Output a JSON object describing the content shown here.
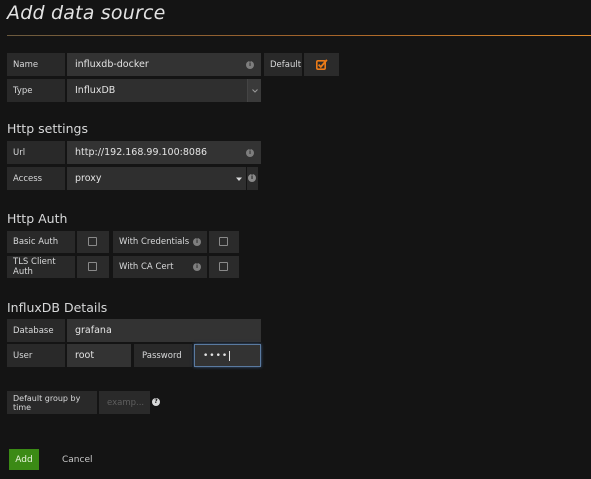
{
  "page": {
    "title": "Add data source"
  },
  "basic": {
    "name_label": "Name",
    "name_value": "influxdb-docker",
    "default_label": "Default",
    "default_checked": true,
    "type_label": "Type",
    "type_value": "InfluxDB"
  },
  "http_settings": {
    "heading": "Http settings",
    "url_label": "Url",
    "url_value": "http://192.168.99.100:8086",
    "access_label": "Access",
    "access_value": "proxy"
  },
  "http_auth": {
    "heading": "Http Auth",
    "basic_auth_label": "Basic Auth",
    "with_credentials_label": "With Credentials",
    "tls_client_auth_label": "TLS Client Auth",
    "with_ca_cert_label": "With CA Cert"
  },
  "influxdb": {
    "heading": "InfluxDB Details",
    "database_label": "Database",
    "database_value": "grafana",
    "user_label": "User",
    "user_value": "root",
    "password_label": "Password",
    "password_value": "••••"
  },
  "group_by": {
    "label": "Default group by time",
    "placeholder": "examp..."
  },
  "actions": {
    "add_label": "Add",
    "cancel_label": "Cancel"
  },
  "colors": {
    "background": "#141414",
    "accent_orange": "#eb7b18",
    "add_button": "#3b8a15",
    "focus_border": "#5a7aa0"
  }
}
